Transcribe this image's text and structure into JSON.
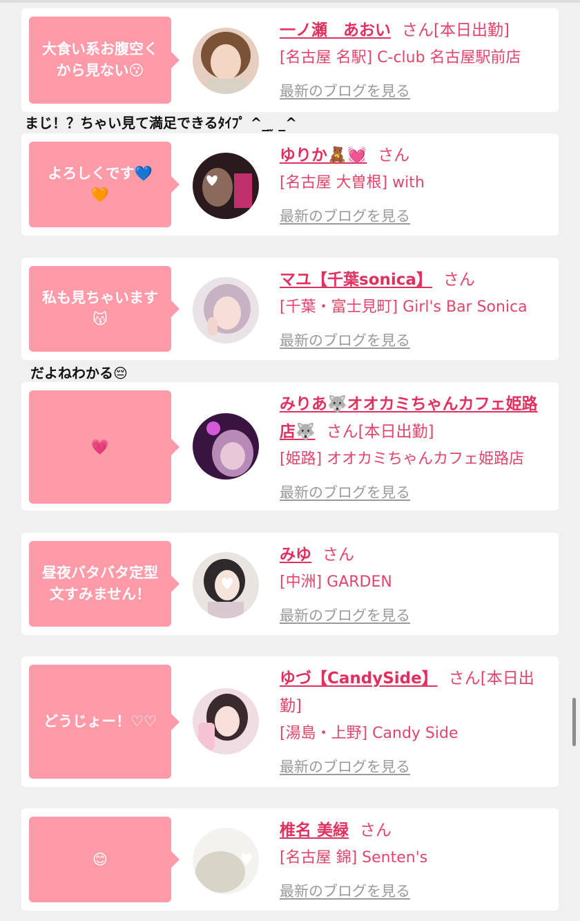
{
  "cards": [
    {
      "bubble": "大食い系お腹空くから見ない😗",
      "name": "一ノ瀬　あおい",
      "san": "さん[本日出勤]",
      "shop": "[名古屋 名駅] C-club 名古屋駅前店",
      "blog": "最新のブログを見る"
    },
    {
      "bubble": "よろしくです💙🧡",
      "name": "ゆりか🧸💓",
      "san": "さん",
      "shop": "[名古屋 大曽根] with",
      "blog": "最新のブログを見る"
    },
    {
      "bubble": "私も見ちゃいます😽",
      "name": "マユ【千葉sonica】",
      "san": "さん",
      "shop": "[千葉・富士見町] Girl's Bar Sonica",
      "blog": "最新のブログを見る"
    },
    {
      "bubble": "💗",
      "name": "みりあ🐺オオカミちゃんカフェ姫路店🐺",
      "san": "さん[本日出勤]",
      "shop": "[姫路] オオカミちゃんカフェ姫路店",
      "blog": "最新のブログを見る"
    },
    {
      "bubble": "昼夜バタバタ定型文すみません！",
      "name": "みゆ",
      "san": "さん",
      "shop": "[中洲] GARDEN",
      "blog": "最新のブログを見る"
    },
    {
      "bubble": "どうじょー！♡♡",
      "name": "ゆづ【CandySide】",
      "san": "さん[本日出勤]",
      "shop": "[湯島・上野] Candy Side",
      "blog": "最新のブログを見る"
    },
    {
      "bubble": "😊",
      "name": "椎名 美緑",
      "san": "さん",
      "shop": "[名古屋 錦] Senten's",
      "blog": "最新のブログを見る"
    }
  ],
  "comments": {
    "after_card_1": "まじ！？ちゃい見て満足できるﾀｲﾌﾟ ^_ ̫ _^",
    "after_card_3": "だよねわかる😔"
  },
  "colors": {
    "bubble": "#ff9aa8",
    "name": "#e0305e",
    "shop": "#e0456a",
    "blog": "#9a9a9a",
    "background": "#f0f0f0"
  }
}
